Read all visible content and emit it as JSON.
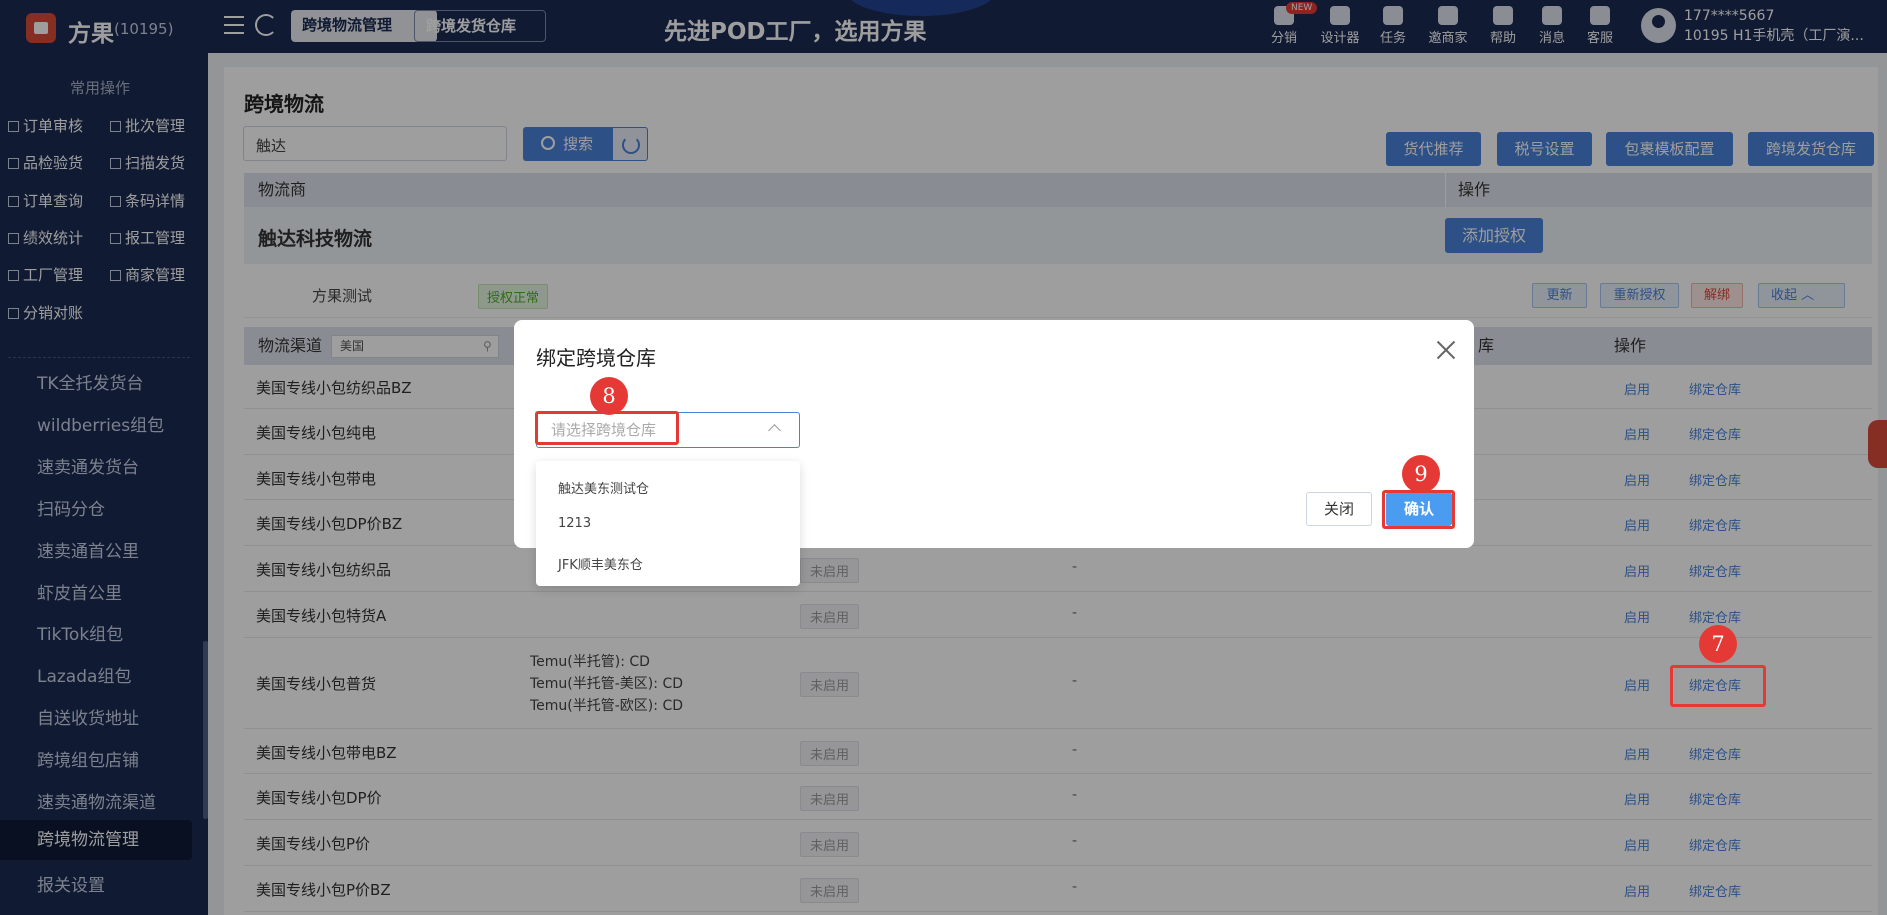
{
  "header": {
    "brand": "方果",
    "brand_count": "(10195)",
    "tabs": [
      "跨境物流管理",
      "跨境发货仓库"
    ],
    "slogan": "先进POD工厂，选用方果",
    "new_badge": "NEW",
    "tools": [
      "分销",
      "设计器",
      "任务",
      "邀商家",
      "帮助",
      "消息",
      "客服"
    ],
    "user_phone": "177****5667",
    "user_org": "10195  H1手机壳（工厂演..."
  },
  "sidebar": {
    "common_title": "常用操作",
    "quick_ops": [
      "订单审核",
      "批次管理",
      "品检验货",
      "扫描发货",
      "订单查询",
      "条码详情",
      "绩效统计",
      "报工管理",
      "工厂管理",
      "商家管理",
      "分销对账"
    ],
    "menu": [
      "TK全托发货台",
      "wildberries组包",
      "速卖通发货台",
      "扫码分仓",
      "速卖通首公里",
      "虾皮首公里",
      "TikTok组包",
      "Lazada组包",
      "自送收货地址",
      "跨境组包店铺",
      "速卖通物流渠道",
      "跨境物流管理",
      "报关设置"
    ],
    "active": "跨境物流管理"
  },
  "page": {
    "title": "跨境物流",
    "search_value": "触达",
    "search_label": "搜索",
    "action_buttons": [
      "货代推荐",
      "税号设置",
      "包裹模板配置",
      "跨境发货仓库"
    ],
    "col_provider": "物流商",
    "col_op": "操作",
    "provider_name": "触达科技物流",
    "add_auth": "添加授权",
    "account_name": "方果测试",
    "account_status": "授权正常",
    "account_btns": [
      "更新",
      "重新授权",
      "解绑",
      "收起"
    ],
    "channel_label": "物流渠道",
    "channel_filter": "美国",
    "channel_op": "操作",
    "rows": [
      {
        "name": "美国专线小包纺织品BZ",
        "status": "",
        "dash": ""
      },
      {
        "name": "美国专线小包纯电",
        "status": "",
        "dash": ""
      },
      {
        "name": "美国专线小包带电",
        "status": "",
        "dash": ""
      },
      {
        "name": "美国专线小包DP价BZ",
        "status": "",
        "dash": ""
      },
      {
        "name": "美国专线小包纺织品",
        "status": "未启用",
        "dash": "-"
      },
      {
        "name": "美国专线小包特货A",
        "status": "未启用",
        "dash": "-"
      },
      {
        "name": "美国专线小包普货",
        "status": "未启用",
        "dash": "-"
      },
      {
        "name": "美国专线小包带电BZ",
        "status": "未启用",
        "dash": "-"
      },
      {
        "name": "美国专线小包DP价",
        "status": "未启用",
        "dash": "-"
      },
      {
        "name": "美国专线小包P价",
        "status": "未启用",
        "dash": "-"
      },
      {
        "name": "美国专线小包P价BZ",
        "status": "未启用",
        "dash": "-"
      }
    ],
    "temu_lines": [
      "Temu(半托管): CD",
      "Temu(半托管-美区): CD",
      "Temu(半托管-欧区): CD"
    ],
    "enable_label": "启用",
    "bind_label": "绑定仓库",
    "partial_header": "库"
  },
  "modal": {
    "title": "绑定跨境仓库",
    "select_placeholder": "请选择跨境仓库",
    "options": [
      "触达美东测试仓",
      "1213",
      "JFK顺丰美东仓"
    ],
    "close_label": "关闭",
    "confirm_label": "确认"
  },
  "annotations": [
    "7",
    "8",
    "9"
  ],
  "colors": {
    "navy": "#1b2a52",
    "accent": "#4a82d8",
    "highlight": "#e53935"
  }
}
